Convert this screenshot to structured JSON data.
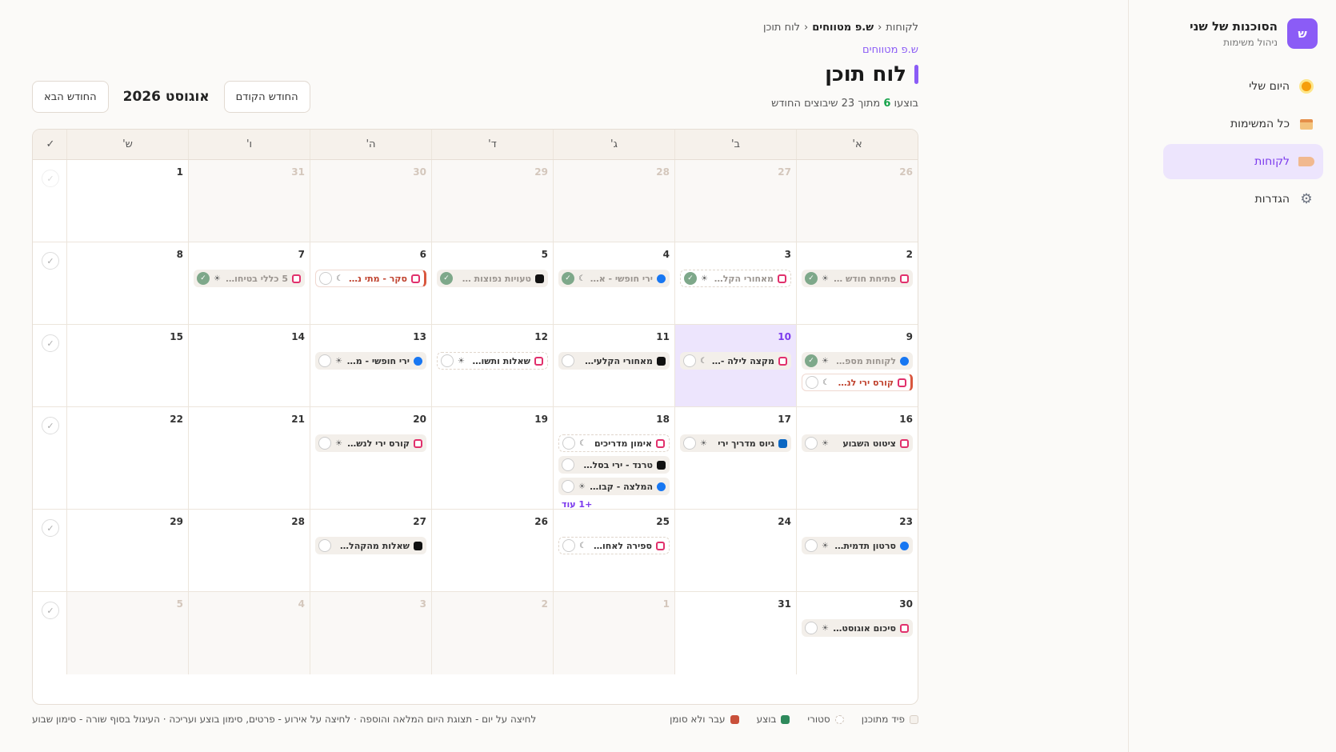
{
  "sidebar": {
    "logo_letter": "ש",
    "brand_name": "הסוכנות של שני",
    "brand_sub": "ניהול משימות",
    "items": [
      {
        "label": "היום שלי",
        "icon": "sun-icon",
        "active": false
      },
      {
        "label": "כל המשימות",
        "icon": "box-icon",
        "active": false
      },
      {
        "label": "לקוחות",
        "icon": "tag-icon",
        "active": true
      },
      {
        "label": "הגדרות",
        "icon": "gear-icon",
        "active": false
      }
    ]
  },
  "header": {
    "breadcrumb": [
      "לקוחות",
      "ש.פ מטווחים",
      "לוח תוכן"
    ],
    "breadcrumb_sep": "‹",
    "subclient": "ש.פ מטווחים",
    "title": "לוח תוכן",
    "progress_prefix": "בוצעו",
    "progress_done": "6",
    "progress_suffix": "מתוך 23 שיבוצים החודש",
    "prev_month": "החודש הקודם",
    "month_label": "אוגוסט 2026",
    "next_month": "החודש הבא"
  },
  "calendar": {
    "weekdays": [
      "א'",
      "ב'",
      "ג'",
      "ד'",
      "ה'",
      "ו'",
      "ש'"
    ],
    "check_header": "✓",
    "weeks": [
      {
        "days": [
          {
            "num": "26",
            "out": true,
            "tasks": []
          },
          {
            "num": "27",
            "out": true,
            "tasks": []
          },
          {
            "num": "28",
            "out": true,
            "tasks": []
          },
          {
            "num": "29",
            "out": true,
            "tasks": []
          },
          {
            "num": "30",
            "out": true,
            "tasks": []
          },
          {
            "num": "31",
            "out": true,
            "tasks": []
          },
          {
            "num": "1",
            "out": false,
            "tasks": []
          }
        ],
        "check_dim": true
      },
      {
        "days": [
          {
            "num": "2",
            "tasks": [
              {
                "name": "פתיחת חודש -...",
                "platform": "instagram",
                "time": "☀",
                "state": "done"
              }
            ]
          },
          {
            "num": "3",
            "tasks": [
              {
                "name": "מאחורי הקלעי...",
                "platform": "instagram",
                "time": "☀",
                "state": "done-story"
              }
            ]
          },
          {
            "num": "4",
            "tasks": [
              {
                "name": "ירי חופשי - א...",
                "platform": "facebook",
                "time": "☾",
                "state": "done"
              }
            ]
          },
          {
            "num": "5",
            "tasks": [
              {
                "name": "טעויות נפוצות ש...",
                "platform": "tiktok",
                "time": "",
                "state": "done"
              }
            ]
          },
          {
            "num": "6",
            "tasks": [
              {
                "name": "סקר - מתי נוח ...",
                "platform": "instagram",
                "time": "☾",
                "state": "missed"
              }
            ]
          },
          {
            "num": "7",
            "tasks": [
              {
                "name": "5 כללי בטיחות...",
                "platform": "instagram",
                "time": "☀",
                "state": "done"
              }
            ]
          },
          {
            "num": "8",
            "tasks": []
          }
        ],
        "check_dim": false
      },
      {
        "days": [
          {
            "num": "9",
            "tasks": [
              {
                "name": "לקוחות מספרי...",
                "platform": "facebook",
                "time": "☀",
                "state": "done"
              },
              {
                "name": "קורס ירי לנשי...",
                "platform": "instagram",
                "time": "☾",
                "state": "missed"
              }
            ]
          },
          {
            "num": "10",
            "today": true,
            "tasks": [
              {
                "name": "מקצה לילה - ת...",
                "platform": "instagram",
                "time": "☾",
                "state": "planned"
              }
            ]
          },
          {
            "num": "11",
            "tasks": [
              {
                "name": "מאחורי הקלעים -...",
                "platform": "tiktok",
                "time": "",
                "state": "planned"
              }
            ]
          },
          {
            "num": "12",
            "tasks": [
              {
                "name": "שאלות ותשובות",
                "platform": "instagram",
                "time": "☀",
                "state": "story"
              }
            ]
          },
          {
            "num": "13",
            "tasks": [
              {
                "name": "ירי חופשי - מ...",
                "platform": "facebook",
                "time": "☀",
                "state": "planned"
              }
            ]
          },
          {
            "num": "14",
            "tasks": []
          },
          {
            "num": "15",
            "tasks": []
          }
        ],
        "check_dim": false
      },
      {
        "days": [
          {
            "num": "16",
            "tasks": [
              {
                "name": "ציטוט השבוע",
                "platform": "instagram",
                "time": "☀",
                "state": "planned"
              }
            ]
          },
          {
            "num": "17",
            "tasks": [
              {
                "name": "גיוס מדריך ירי",
                "platform": "linkedin",
                "time": "☀",
                "state": "planned"
              }
            ]
          },
          {
            "num": "18",
            "tasks": [
              {
                "name": "אימון מדריכים",
                "platform": "instagram",
                "time": "☾",
                "state": "story"
              },
              {
                "name": "טרנד - ירי בסלואו...",
                "platform": "tiktok",
                "time": "",
                "state": "planned"
              },
              {
                "name": "המלצה - קבוצ...",
                "platform": "facebook",
                "time": "☀",
                "state": "planned"
              }
            ],
            "more": "+1 עוד"
          },
          {
            "num": "19",
            "tasks": []
          },
          {
            "num": "20",
            "tasks": [
              {
                "name": "קורס ירי לנשי...",
                "platform": "instagram",
                "time": "☀",
                "state": "planned"
              }
            ]
          },
          {
            "num": "21",
            "tasks": []
          },
          {
            "num": "22",
            "tasks": []
          }
        ],
        "check_dim": false
      },
      {
        "days": [
          {
            "num": "23",
            "tasks": [
              {
                "name": "סרטון תדמית ח...",
                "platform": "facebook",
                "time": "☀",
                "state": "planned"
              }
            ]
          },
          {
            "num": "24",
            "tasks": []
          },
          {
            "num": "25",
            "tasks": [
              {
                "name": "ספירה לאחור ...",
                "platform": "instagram",
                "time": "☾",
                "state": "story"
              }
            ]
          },
          {
            "num": "26",
            "tasks": []
          },
          {
            "num": "27",
            "tasks": [
              {
                "name": "שאלות מהקהל - ...",
                "platform": "tiktok",
                "time": "",
                "state": "planned"
              }
            ]
          },
          {
            "num": "28",
            "tasks": []
          },
          {
            "num": "29",
            "tasks": []
          }
        ],
        "check_dim": false
      },
      {
        "days": [
          {
            "num": "30",
            "tasks": [
              {
                "name": "סיכום אוגוסט ...",
                "platform": "instagram",
                "time": "☀",
                "state": "planned"
              }
            ]
          },
          {
            "num": "31",
            "tasks": []
          },
          {
            "num": "1",
            "out": true,
            "tasks": []
          },
          {
            "num": "2",
            "out": true,
            "tasks": []
          },
          {
            "num": "3",
            "out": true,
            "tasks": []
          },
          {
            "num": "4",
            "out": true,
            "tasks": []
          },
          {
            "num": "5",
            "out": true,
            "tasks": []
          }
        ],
        "check_dim": false
      }
    ]
  },
  "legend": {
    "planned": "פיד מתוכנן",
    "story": "סטורי",
    "done": "בוצע",
    "missed": "עבר ולא סומן",
    "hint": "לחיצה על יום - תצוגת היום המלאה והוספה · לחיצה על אירוע - פרטים, סימון בוצע ועריכה · העיגול בסוף שורה - סימון שבוע"
  }
}
